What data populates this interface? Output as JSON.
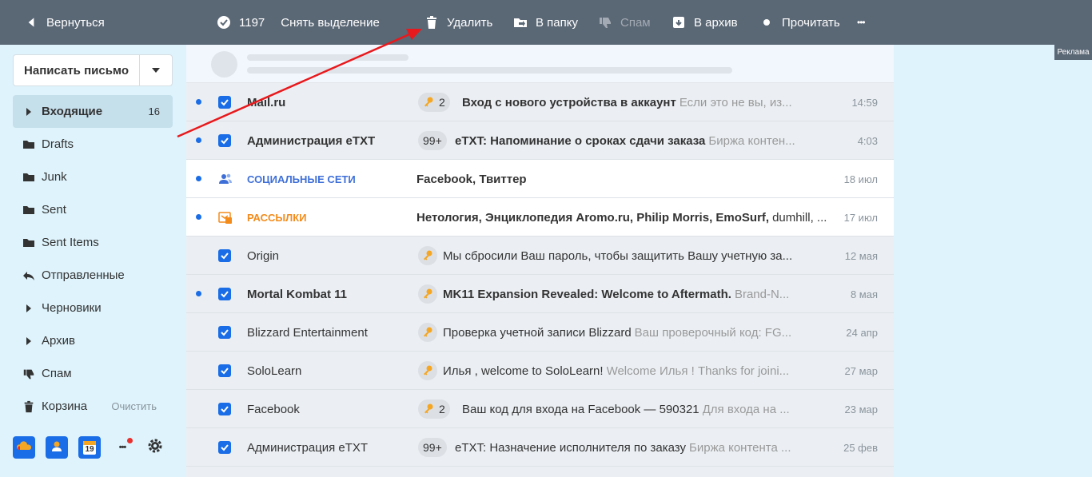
{
  "toolbar": {
    "back_label": "Вернуться",
    "selected_count": "1197",
    "deselect_label": "Снять выделение",
    "delete_label": "Удалить",
    "to_folder_label": "В папку",
    "spam_label": "Спам",
    "archive_label": "В архив",
    "read_label": "Прочитать",
    "more_label": "•••"
  },
  "ad_label": "Реклама",
  "sidebar": {
    "compose_label": "Написать письмо",
    "folders": [
      {
        "label": "Входящие",
        "count": "16"
      },
      {
        "label": "Drafts"
      },
      {
        "label": "Junk"
      },
      {
        "label": "Sent"
      },
      {
        "label": "Sent Items"
      },
      {
        "label": "Отправленные"
      },
      {
        "label": "Черновики"
      },
      {
        "label": "Архив"
      },
      {
        "label": "Спам"
      },
      {
        "label": "Корзина",
        "action": "Очистить"
      }
    ],
    "calendar_day": "19",
    "more_label": "•••"
  },
  "mails": [
    {
      "sender": "Mail.ru",
      "badge": "2",
      "subject": "Вход с нового устройства в аккаунт",
      "snippet": "Если это не вы, из...",
      "date": "14:59"
    },
    {
      "sender": "Администрация eTXT",
      "badge": "99+",
      "subject": "eTXT: Напоминание о сроках сдачи заказа",
      "snippet": "Биржа контен...",
      "date": "4:03"
    },
    {
      "sender": "СОЦИАЛЬНЫЕ СЕТИ",
      "subject": "Facebook, Твиттер",
      "snippet": "",
      "date": "18 июл"
    },
    {
      "sender": "РАССЫЛКИ",
      "subject": "Нетология, Энциклопедия Aromo.ru, Philip Morris, EmoSurf,",
      "snippet": "dumhill, ...",
      "date": "17 июл"
    },
    {
      "sender": "Origin",
      "subject": "Мы сбросили Ваш пароль, чтобы защитить Вашу учетную за...",
      "snippet": "",
      "date": "12 мая"
    },
    {
      "sender": "Mortal Kombat 11",
      "subject": "MK11 Expansion Revealed: Welcome to Aftermath.",
      "snippet": "Brand-N...",
      "date": "8 мая"
    },
    {
      "sender": "Blizzard Entertainment",
      "subject": "Проверка учетной записи Blizzard",
      "snippet": "Ваш проверочный код: FG...",
      "date": "24 апр"
    },
    {
      "sender": "SoloLearn",
      "subject": "Илья , welcome to SoloLearn!",
      "snippet": "Welcome Илья ! Thanks for joini...",
      "date": "27 мар"
    },
    {
      "sender": "Facebook",
      "badge": "2",
      "subject": "Ваш код для входа на Facebook — 590321",
      "snippet": "Для входа на ...",
      "date": "23 мар"
    },
    {
      "sender": "Администрация eTXT",
      "badge": "99+",
      "subject": "eTXT: Назначение исполнителя по заказу",
      "snippet": "Биржа контента ...",
      "date": "25 фев"
    }
  ],
  "colors": {
    "toolbar": "#5a6775",
    "accent": "#1a6de6",
    "social": "#3e6fd8",
    "news": "#f38b1b",
    "key": "#f5a623",
    "annotation_arrow": "#e8191c"
  }
}
